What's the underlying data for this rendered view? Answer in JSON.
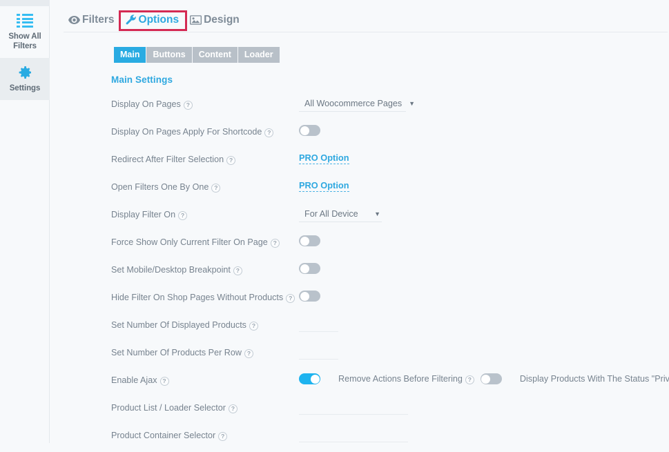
{
  "sidebar": {
    "items": [
      {
        "label": "Show All Filters",
        "icon": "list-icon",
        "active": false
      },
      {
        "label": "Settings",
        "icon": "gear-icon",
        "active": true
      }
    ]
  },
  "top_tabs": [
    {
      "label": "Filters",
      "icon": "eye-icon",
      "active": false,
      "highlighted": false
    },
    {
      "label": "Options",
      "icon": "wrench-icon",
      "active": true,
      "highlighted": true
    },
    {
      "label": "Design",
      "icon": "image-icon",
      "active": false,
      "highlighted": false
    }
  ],
  "sub_tabs": [
    {
      "label": "Main",
      "active": true
    },
    {
      "label": "Buttons",
      "active": false
    },
    {
      "label": "Content",
      "active": false
    },
    {
      "label": "Loader",
      "active": false
    }
  ],
  "section": {
    "title": "Main Settings"
  },
  "help_glyph": "?",
  "caret_glyph": "▼",
  "colors": {
    "accent_blue": "#29abe2",
    "link_blue": "#2ea8e0",
    "toggle_on": "#1eb3ef",
    "toggle_off": "#b9c2cb",
    "highlight_box": "#d42a53",
    "label_text": "#77838f",
    "page_bg": "#f7f9fb"
  },
  "rows": [
    {
      "label": "Display On Pages",
      "control": "select",
      "value": "All Woocommerce Pages"
    },
    {
      "label": "Display On Pages Apply For Shortcode",
      "control": "toggle",
      "value": "off"
    },
    {
      "label": "Redirect After Filter Selection",
      "control": "pro",
      "value": "PRO Option"
    },
    {
      "label": "Open Filters One By One",
      "control": "pro",
      "value": "PRO Option"
    },
    {
      "label": "Display Filter On",
      "control": "select",
      "value": "For All Device"
    },
    {
      "label": "Force Show Only Current Filter On Page",
      "control": "toggle",
      "value": "off"
    },
    {
      "label": "Set Mobile/Desktop Breakpoint",
      "control": "toggle",
      "value": "off"
    },
    {
      "label": "Hide Filter On Shop Pages Without Products",
      "control": "toggle",
      "value": "off"
    },
    {
      "label": "Set Number Of Displayed Products",
      "control": "input-small",
      "value": ""
    },
    {
      "label": "Set Number Of Products Per Row",
      "control": "input-small",
      "value": ""
    },
    {
      "label": "Enable Ajax",
      "control": "toggle-group",
      "value": "on",
      "extras": [
        {
          "label": "Remove Actions Before Filtering",
          "value": "off"
        },
        {
          "label": "Display Products With The Status \"Private\"",
          "value": "off"
        }
      ]
    },
    {
      "label": "Product List / Loader Selector",
      "control": "input-wide",
      "value": ""
    },
    {
      "label": "Product Container Selector",
      "control": "input-wide",
      "value": ""
    }
  ]
}
